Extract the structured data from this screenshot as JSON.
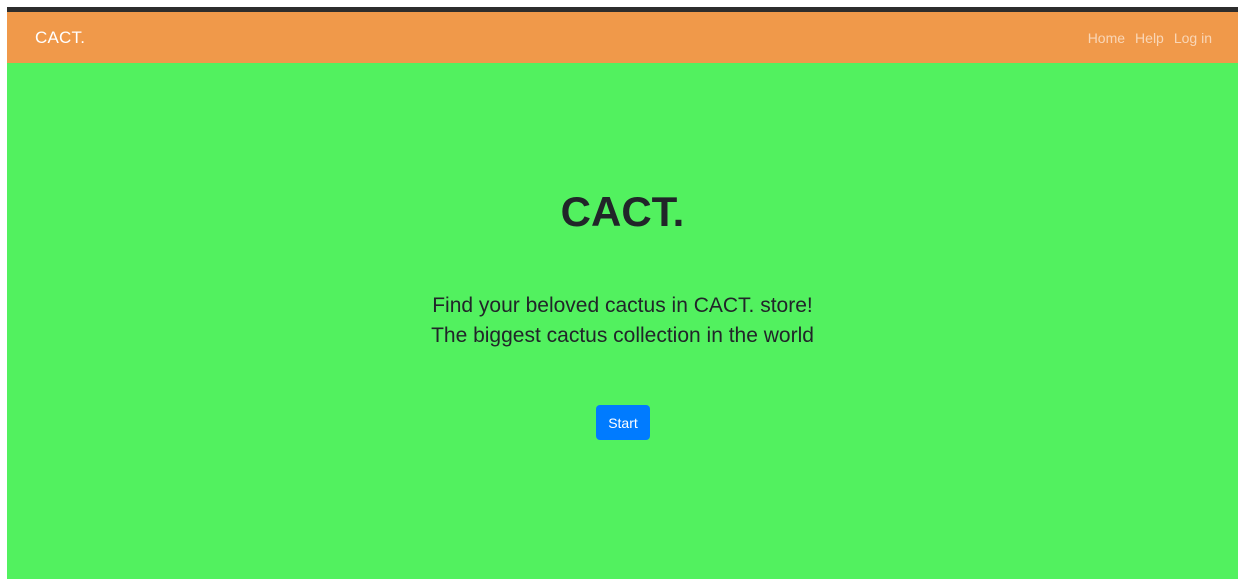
{
  "navbar": {
    "brand": "CACT.",
    "links": [
      "Home",
      "Help",
      "Log in"
    ]
  },
  "hero": {
    "title": "CACT.",
    "lines": [
      "Find your beloved cactus in CACT. store!",
      "The biggest cactus collection in the world"
    ],
    "button_label": "Start"
  },
  "colors": {
    "navbar_bg": "#f0994a",
    "hero_bg": "#52f15f",
    "button_bg": "#007bff"
  }
}
